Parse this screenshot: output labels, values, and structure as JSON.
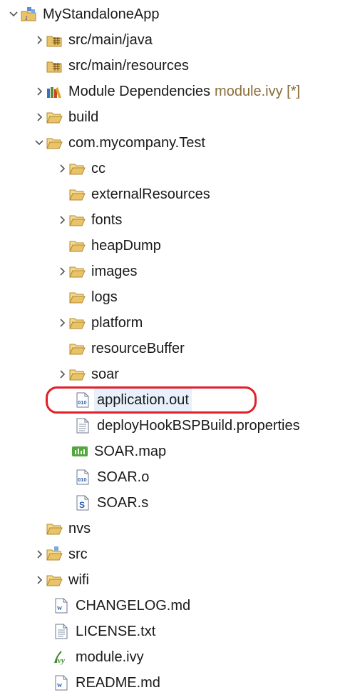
{
  "tree": {
    "project": {
      "label": "MyStandaloneApp",
      "icon": "project-icon"
    },
    "src_main_java": {
      "label": "src/main/java",
      "icon": "source-folder-icon"
    },
    "src_main_resources": {
      "label": "src/main/resources",
      "icon": "source-folder-icon"
    },
    "module_deps": {
      "label": "Module Dependencies",
      "decoration": "module.ivy [*]",
      "icon": "library-icon"
    },
    "build": {
      "label": "build",
      "icon": "folder-icon"
    },
    "com_mycompany_test": {
      "label": "com.mycompany.Test",
      "icon": "folder-icon"
    },
    "cc": {
      "label": "cc",
      "icon": "folder-icon"
    },
    "external_resources": {
      "label": "externalResources",
      "icon": "folder-icon"
    },
    "fonts": {
      "label": "fonts",
      "icon": "folder-icon"
    },
    "heap_dump": {
      "label": "heapDump",
      "icon": "folder-icon"
    },
    "images": {
      "label": "images",
      "icon": "folder-icon"
    },
    "logs": {
      "label": "logs",
      "icon": "folder-icon"
    },
    "platform": {
      "label": "platform",
      "icon": "folder-icon"
    },
    "resource_buffer": {
      "label": "resourceBuffer",
      "icon": "folder-icon"
    },
    "soar": {
      "label": "soar",
      "icon": "folder-icon"
    },
    "application_out": {
      "label": "application.out",
      "icon": "binary-file-icon"
    },
    "deploy_hook": {
      "label": "deployHookBSPBuild.properties",
      "icon": "text-file-icon"
    },
    "soar_map": {
      "label": "SOAR.map",
      "icon": "map-file-icon"
    },
    "soar_o": {
      "label": "SOAR.o",
      "icon": "binary-file-icon"
    },
    "soar_s": {
      "label": "SOAR.s",
      "icon": "assembly-file-icon"
    },
    "nvs": {
      "label": "nvs",
      "icon": "folder-icon"
    },
    "src": {
      "label": "src",
      "icon": "source-folder-icon"
    },
    "wifi": {
      "label": "wifi",
      "icon": "folder-icon"
    },
    "changelog": {
      "label": "CHANGELOG.md",
      "icon": "markdown-file-icon"
    },
    "license": {
      "label": "LICENSE.txt",
      "icon": "text-file-icon"
    },
    "module_ivy": {
      "label": "module.ivy",
      "icon": "ivy-file-icon"
    },
    "readme": {
      "label": "README.md",
      "icon": "markdown-file-icon"
    }
  },
  "colors": {
    "folder": "#e8c36a",
    "highlight": "#e0202a",
    "selection": "#e7f0fb"
  }
}
